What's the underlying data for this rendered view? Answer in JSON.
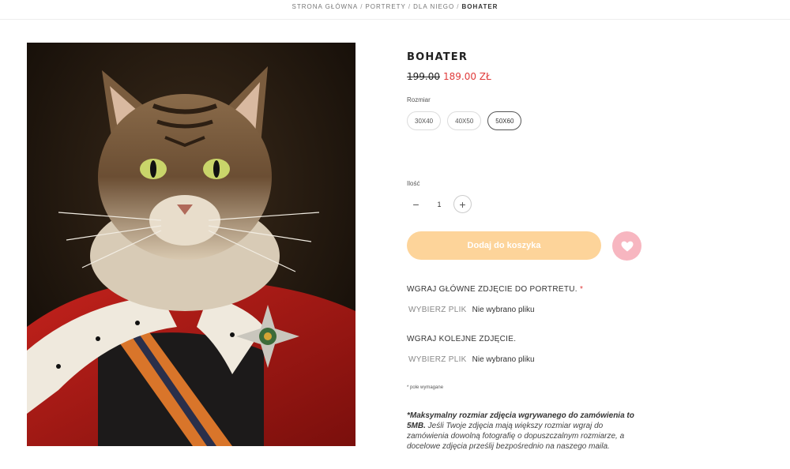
{
  "breadcrumb": {
    "items": [
      "STRONA GŁÓWNA",
      "PORTRETY",
      "DLA NIEGO"
    ],
    "separator": "/",
    "current": "BOHATER"
  },
  "product": {
    "title": "BOHATER",
    "old_price": "199.00",
    "new_price": "189.00 ZŁ"
  },
  "size": {
    "label": "Rozmiar",
    "options": [
      "30X40",
      "40X50",
      "50X60"
    ],
    "selected": "50X60"
  },
  "quantity": {
    "label": "Ilość",
    "value": "1",
    "minus": "−",
    "plus": "+"
  },
  "cart": {
    "add_label": "Dodaj do koszyka"
  },
  "uploads": [
    {
      "label": "WGRAJ GŁÓWNE ZDJĘCIE DO PORTRETU.",
      "required_mark": "*",
      "button": "WYBIERZ PLIK",
      "status": "Nie wybrano pliku"
    },
    {
      "label": "WGRAJ KOLEJNE ZDJĘCIE.",
      "required_mark": "",
      "button": "WYBIERZ PLIK",
      "status": "Nie wybrano pliku"
    }
  ],
  "required_note": "* pole wymagane",
  "info": {
    "bold": "*Maksymalny rozmiar zdjęcia wgrywanego do zamówienia to 5MB.",
    "text": " Jeśli Twoje zdjęcia mają większy rozmiar wgraj do zamówienia dowolną fotografię o dopuszczalnym rozmiarze, a docelowe zdjęcia prześlij bezpośrednio na naszego maila."
  },
  "colors": {
    "accent_button": "#fdd49a",
    "wishlist": "#f7b6c0",
    "sale_price": "#e03a3a"
  }
}
